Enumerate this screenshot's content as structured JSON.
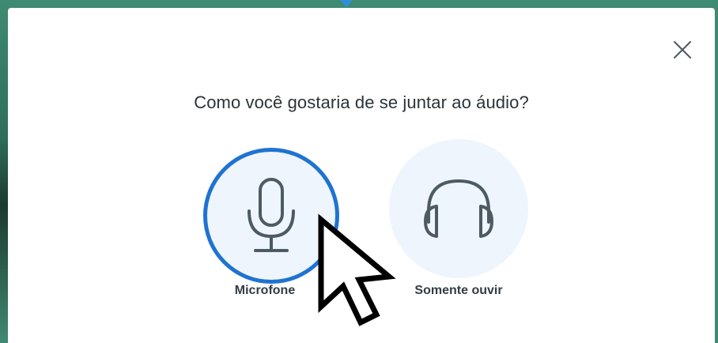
{
  "dialog": {
    "prompt": "Como você gostaria de se juntar ao áudio?",
    "close_icon": "close-icon",
    "options": [
      {
        "label": "Microfone",
        "icon": "microphone-icon",
        "selected": true
      },
      {
        "label": "Somente ouvir",
        "icon": "headphones-icon",
        "selected": false
      }
    ]
  },
  "colors": {
    "accent": "#1f73d1",
    "option_bg": "#eef5fc",
    "icon": "#4d5a63",
    "background": "#3f8a72"
  }
}
